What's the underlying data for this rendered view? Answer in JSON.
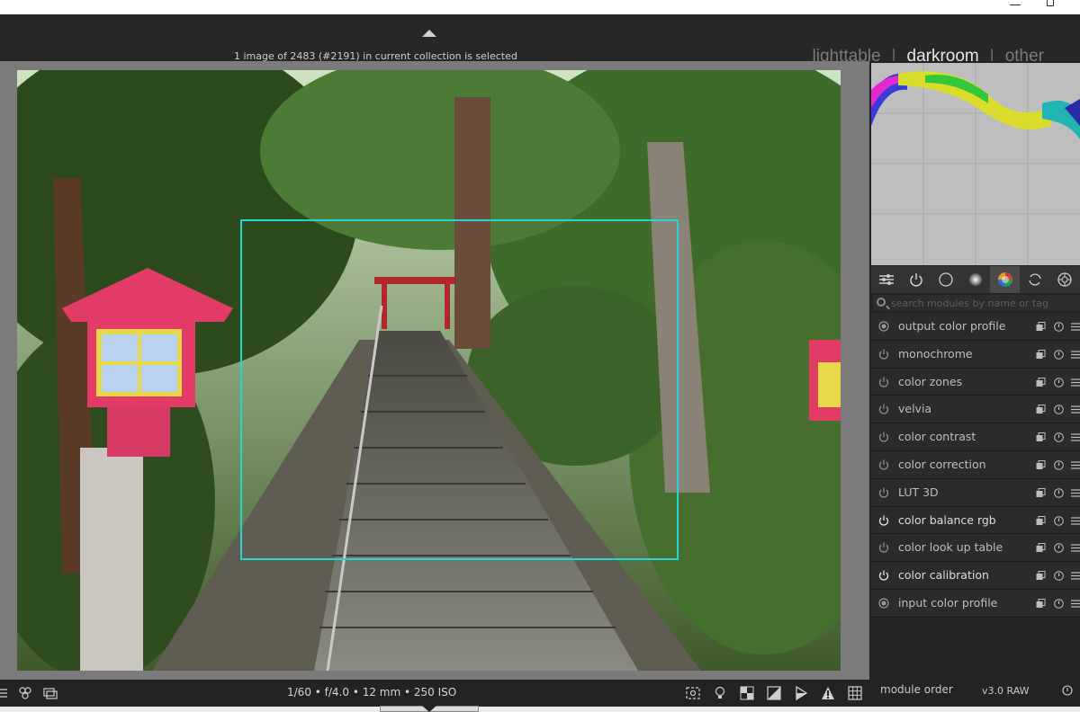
{
  "header": {
    "selection_info": "1 image of 2483 (#2191) in current collection is selected",
    "views": [
      "lighttable",
      "darkroom",
      "other"
    ],
    "active_view": "darkroom"
  },
  "search": {
    "placeholder": "search modules by name or tag"
  },
  "module_groups": [
    {
      "name": "quick-access-icon"
    },
    {
      "name": "active-modules-icon"
    },
    {
      "name": "base-group-icon"
    },
    {
      "name": "tone-group-icon"
    },
    {
      "name": "color-group-icon",
      "active": true
    },
    {
      "name": "correct-group-icon"
    },
    {
      "name": "effect-group-icon"
    }
  ],
  "modules": [
    {
      "label": "output color profile",
      "state": "locked"
    },
    {
      "label": "monochrome",
      "state": "off"
    },
    {
      "label": "color zones",
      "state": "off"
    },
    {
      "label": "velvia",
      "state": "off"
    },
    {
      "label": "color contrast",
      "state": "off"
    },
    {
      "label": "color correction",
      "state": "off"
    },
    {
      "label": "LUT 3D",
      "state": "off"
    },
    {
      "label": "color balance rgb",
      "state": "on"
    },
    {
      "label": "color look up table",
      "state": "off"
    },
    {
      "label": "color calibration",
      "state": "on"
    },
    {
      "label": "input color profile",
      "state": "locked"
    }
  ],
  "bottom": {
    "exif": "1/60 • f/4.0 • 12 mm • 250 ISO",
    "module_order_label": "module order",
    "module_order_value": "v3.0 RAW"
  },
  "colors": {
    "focus_box": "#27d3d3",
    "panel_bg": "#242424",
    "histogram_bg": "#bebebe"
  }
}
